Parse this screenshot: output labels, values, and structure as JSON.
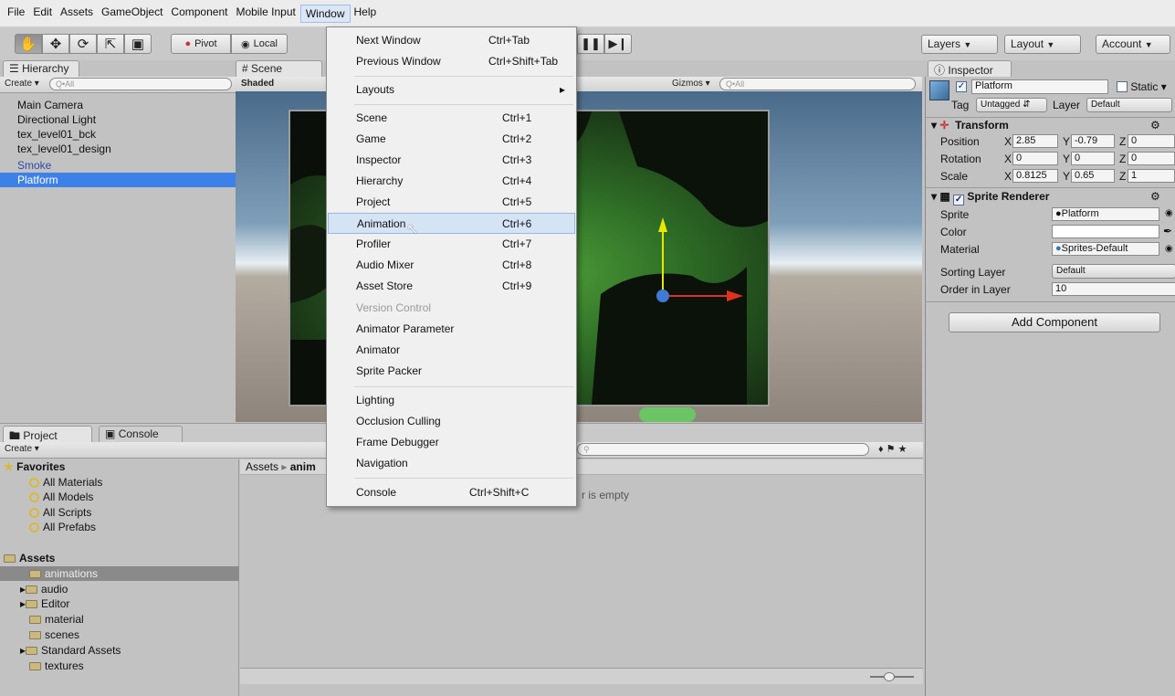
{
  "menubar": [
    "File",
    "Edit",
    "Assets",
    "GameObject",
    "Component",
    "Mobile Input",
    "Window",
    "Help"
  ],
  "toolbar": {
    "pivot": "Pivot",
    "local": "Local",
    "layers": "Layers",
    "layout": "Layout",
    "account": "Account"
  },
  "hierarchy": {
    "tab": "Hierarchy",
    "create": "Create",
    "search": "Q•All",
    "items": [
      "Main Camera",
      "Directional Light",
      "tex_level01_bck",
      "tex_level01_design",
      "Smoke",
      "Platform"
    ]
  },
  "scene": {
    "tab": "Scene",
    "shaded": "Shaded",
    "gizmos": "Gizmos",
    "search": "Q•All"
  },
  "window_menu": {
    "items": [
      {
        "label": "Next Window",
        "shortcut": "Ctrl+Tab"
      },
      {
        "label": "Previous Window",
        "shortcut": "Ctrl+Shift+Tab"
      },
      {
        "label": "Layouts",
        "shortcut": "▸"
      },
      {
        "label": "Scene",
        "shortcut": "Ctrl+1"
      },
      {
        "label": "Game",
        "shortcut": "Ctrl+2"
      },
      {
        "label": "Inspector",
        "shortcut": "Ctrl+3"
      },
      {
        "label": "Hierarchy",
        "shortcut": "Ctrl+4"
      },
      {
        "label": "Project",
        "shortcut": "Ctrl+5"
      },
      {
        "label": "Animation",
        "shortcut": "Ctrl+6"
      },
      {
        "label": "Profiler",
        "shortcut": "Ctrl+7"
      },
      {
        "label": "Audio Mixer",
        "shortcut": "Ctrl+8"
      },
      {
        "label": "Asset Store",
        "shortcut": "Ctrl+9"
      },
      {
        "label": "Version Control",
        "shortcut": ""
      },
      {
        "label": "Animator Parameter",
        "shortcut": ""
      },
      {
        "label": "Animator",
        "shortcut": ""
      },
      {
        "label": "Sprite Packer",
        "shortcut": ""
      },
      {
        "label": "Lighting",
        "shortcut": ""
      },
      {
        "label": "Occlusion Culling",
        "shortcut": ""
      },
      {
        "label": "Frame Debugger",
        "shortcut": ""
      },
      {
        "label": "Navigation",
        "shortcut": ""
      },
      {
        "label": "Console",
        "shortcut": "Ctrl+Shift+C"
      }
    ],
    "highlighted": "Animation",
    "disabled": "Version Control"
  },
  "project": {
    "tab_project": "Project",
    "tab_console": "Console",
    "create": "Create",
    "favorites_label": "Favorites",
    "favorites": [
      "All Materials",
      "All Models",
      "All Scripts",
      "All Prefabs"
    ],
    "assets_label": "Assets",
    "assets": [
      "animations",
      "audio",
      "Editor",
      "material",
      "scenes",
      "Standard Assets",
      "textures"
    ],
    "breadcrumb_root": "Assets",
    "breadcrumb_folder": "anim",
    "empty_message": "r is empty"
  },
  "inspector": {
    "tab": "Inspector",
    "object_name": "Platform",
    "static": "Static",
    "tag_label": "Tag",
    "tag_value": "Untagged",
    "layer_label": "Layer",
    "layer_value": "Default",
    "transform": {
      "title": "Transform",
      "position": {
        "label": "Position",
        "x": "2.85",
        "y": "-0.79",
        "z": "0"
      },
      "rotation": {
        "label": "Rotation",
        "x": "0",
        "y": "0",
        "z": "0"
      },
      "scale": {
        "label": "Scale",
        "x": "0.8125",
        "y": "0.65",
        "z": "1"
      }
    },
    "axis": {
      "x": "X",
      "y": "Y",
      "z": "Z"
    },
    "sprite_renderer": {
      "title": "Sprite Renderer",
      "sprite_label": "Sprite",
      "sprite_value": "Platform",
      "color_label": "Color",
      "material_label": "Material",
      "material_value": "Sprites-Default",
      "sorting_label": "Sorting Layer",
      "sorting_value": "Default",
      "order_label": "Order in Layer",
      "order_value": "10"
    },
    "add_component": "Add Component"
  }
}
